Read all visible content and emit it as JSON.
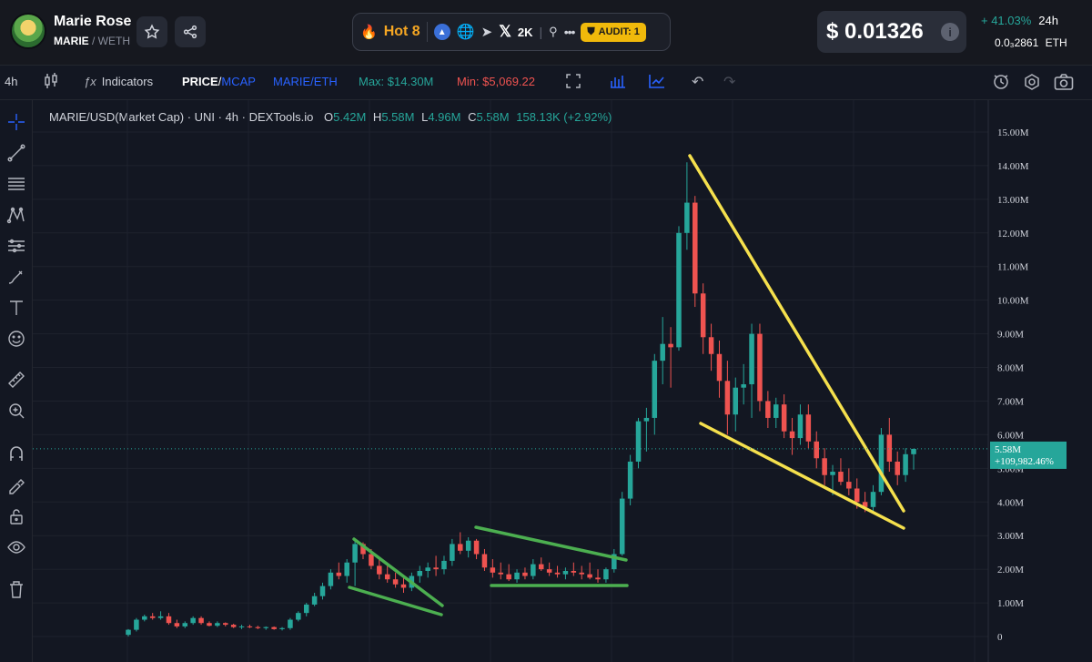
{
  "header": {
    "token_name": "Marie Rose",
    "token_symbol": "MARIE",
    "quote_symbol": "/ WETH",
    "hot_label": "Hot 8",
    "followers": "2K",
    "audit_label": "AUDIT: 1",
    "price": "$ 0.01326",
    "change": "+ 41.03%",
    "change_period": "24h",
    "eth_price": "0.0₃2861",
    "eth_unit": "ETH"
  },
  "toolbar": {
    "interval": "4h",
    "indicators_label": "Indicators",
    "price_label": "PRICE",
    "mcap_label": "MCAP",
    "pair_label": "MARIE/ETH",
    "max_label": "Max: $14.30M",
    "min_label": "Min: $5,069.22"
  },
  "legend": {
    "title": "MARIE/USD(Market Cap) · UNI · 4h · DEXTools.io",
    "o_key": "O",
    "o": "5.42M",
    "h_key": "H",
    "h": "5.58M",
    "l_key": "L",
    "l": "4.96M",
    "c_key": "C",
    "c": "5.58M",
    "change": "158.13K (+2.92%)"
  },
  "colors": {
    "up": "#26a69a",
    "down": "#ef5350",
    "trend_green": "#4caf50",
    "trend_yellow": "#f5e04d",
    "background": "#131722"
  },
  "chart_data": {
    "type": "candlestick",
    "title": "MARIE/USD(Market Cap) · UNI · 4h · DEXTools.io",
    "ylim": [
      0,
      15.5
    ],
    "y_unit": "M",
    "y_ticks": [
      "0",
      "1.00M",
      "2.00M",
      "3.00M",
      "4.00M",
      "5.00M",
      "6.00M",
      "7.00M",
      "8.00M",
      "9.00M",
      "10.00M",
      "11.00M",
      "12.00M",
      "13.00M",
      "14.00M",
      "15.00M"
    ],
    "last_price_label": "5.58M",
    "last_change_label": "+109,982.46%",
    "last_value": 5.58,
    "grid": true,
    "candles": [
      [
        0.05,
        0.22,
        0.0,
        0.2
      ],
      [
        0.2,
        0.55,
        0.15,
        0.5
      ],
      [
        0.5,
        0.65,
        0.45,
        0.6
      ],
      [
        0.6,
        0.7,
        0.5,
        0.55
      ],
      [
        0.55,
        0.75,
        0.5,
        0.6
      ],
      [
        0.6,
        0.7,
        0.35,
        0.4
      ],
      [
        0.4,
        0.5,
        0.25,
        0.3
      ],
      [
        0.3,
        0.45,
        0.25,
        0.4
      ],
      [
        0.4,
        0.6,
        0.35,
        0.55
      ],
      [
        0.55,
        0.6,
        0.35,
        0.4
      ],
      [
        0.4,
        0.45,
        0.3,
        0.32
      ],
      [
        0.32,
        0.45,
        0.28,
        0.4
      ],
      [
        0.4,
        0.42,
        0.3,
        0.35
      ],
      [
        0.35,
        0.38,
        0.25,
        0.28
      ],
      [
        0.28,
        0.35,
        0.22,
        0.3
      ],
      [
        0.3,
        0.35,
        0.25,
        0.28
      ],
      [
        0.28,
        0.32,
        0.22,
        0.25
      ],
      [
        0.25,
        0.3,
        0.2,
        0.28
      ],
      [
        0.28,
        0.3,
        0.2,
        0.22
      ],
      [
        0.22,
        0.28,
        0.18,
        0.25
      ],
      [
        0.25,
        0.55,
        0.2,
        0.5
      ],
      [
        0.5,
        0.75,
        0.45,
        0.7
      ],
      [
        0.7,
        1.0,
        0.6,
        0.95
      ],
      [
        0.95,
        1.3,
        0.9,
        1.2
      ],
      [
        1.2,
        1.6,
        1.1,
        1.5
      ],
      [
        1.5,
        2.0,
        1.4,
        1.9
      ],
      [
        1.9,
        2.2,
        1.7,
        1.8
      ],
      [
        1.8,
        2.3,
        1.6,
        2.2
      ],
      [
        2.2,
        2.9,
        1.5,
        2.75
      ],
      [
        2.75,
        2.8,
        2.3,
        2.45
      ],
      [
        2.45,
        2.6,
        2.0,
        2.1
      ],
      [
        2.1,
        2.3,
        1.7,
        1.85
      ],
      [
        1.85,
        2.1,
        1.6,
        1.7
      ],
      [
        1.7,
        1.9,
        1.45,
        1.55
      ],
      [
        1.55,
        1.8,
        1.3,
        1.45
      ],
      [
        1.45,
        1.9,
        1.35,
        1.8
      ],
      [
        1.8,
        2.1,
        1.6,
        1.95
      ],
      [
        1.95,
        2.2,
        1.75,
        2.05
      ],
      [
        2.05,
        2.4,
        1.8,
        2.0
      ],
      [
        2.0,
        2.4,
        1.85,
        2.25
      ],
      [
        2.25,
        2.9,
        2.1,
        2.75
      ],
      [
        2.75,
        3.1,
        2.45,
        2.55
      ],
      [
        2.55,
        2.95,
        2.35,
        2.85
      ],
      [
        2.85,
        2.9,
        2.3,
        2.45
      ],
      [
        2.45,
        2.6,
        1.95,
        2.05
      ],
      [
        2.05,
        2.3,
        1.75,
        1.9
      ],
      [
        1.9,
        2.2,
        1.7,
        1.85
      ],
      [
        1.85,
        2.15,
        1.65,
        1.7
      ],
      [
        1.7,
        2.0,
        1.6,
        1.9
      ],
      [
        1.9,
        2.05,
        1.7,
        1.8
      ],
      [
        1.8,
        2.3,
        1.7,
        2.15
      ],
      [
        2.15,
        2.35,
        1.95,
        2.0
      ],
      [
        2.0,
        2.2,
        1.8,
        1.9
      ],
      [
        1.9,
        2.1,
        1.75,
        1.85
      ],
      [
        1.85,
        2.05,
        1.7,
        1.95
      ],
      [
        1.95,
        2.2,
        1.8,
        1.9
      ],
      [
        1.9,
        2.1,
        1.7,
        1.85
      ],
      [
        1.85,
        2.2,
        1.7,
        1.75
      ],
      [
        1.75,
        2.0,
        1.6,
        1.7
      ],
      [
        1.7,
        2.05,
        1.6,
        2.0
      ],
      [
        2.0,
        2.6,
        1.9,
        2.45
      ],
      [
        2.45,
        4.3,
        2.4,
        4.1
      ],
      [
        4.1,
        5.4,
        3.9,
        5.2
      ],
      [
        5.2,
        6.5,
        5.0,
        6.4
      ],
      [
        6.4,
        6.8,
        5.5,
        6.5
      ],
      [
        6.5,
        8.4,
        6.0,
        8.2
      ],
      [
        8.2,
        9.5,
        7.5,
        8.7
      ],
      [
        8.7,
        9.2,
        7.4,
        8.6
      ],
      [
        8.6,
        12.2,
        8.5,
        12.0
      ],
      [
        12.0,
        14.1,
        11.5,
        12.9
      ],
      [
        12.9,
        13.1,
        9.8,
        10.2
      ],
      [
        10.2,
        10.5,
        8.4,
        8.9
      ],
      [
        8.9,
        9.3,
        7.9,
        8.4
      ],
      [
        8.4,
        8.8,
        7.1,
        7.6
      ],
      [
        7.6,
        8.2,
        6.0,
        6.6
      ],
      [
        6.6,
        7.7,
        6.1,
        7.4
      ],
      [
        7.4,
        8.1,
        6.9,
        7.5
      ],
      [
        7.5,
        9.3,
        6.5,
        9.0
      ],
      [
        9.0,
        9.3,
        6.7,
        7.0
      ],
      [
        7.0,
        7.3,
        6.2,
        6.5
      ],
      [
        6.5,
        7.1,
        6.2,
        6.9
      ],
      [
        6.9,
        7.2,
        5.9,
        6.1
      ],
      [
        6.1,
        6.5,
        5.4,
        5.9
      ],
      [
        5.9,
        6.9,
        5.7,
        6.6
      ],
      [
        6.6,
        6.9,
        5.6,
        5.8
      ],
      [
        5.8,
        6.1,
        5.0,
        5.3
      ],
      [
        5.3,
        5.6,
        4.5,
        4.8
      ],
      [
        4.8,
        5.1,
        4.2,
        4.9
      ],
      [
        4.9,
        5.3,
        4.5,
        4.6
      ],
      [
        4.6,
        5.0,
        4.2,
        4.4
      ],
      [
        4.4,
        4.7,
        3.8,
        4.0
      ],
      [
        4.0,
        4.3,
        3.7,
        3.85
      ],
      [
        3.85,
        4.5,
        3.7,
        4.3
      ],
      [
        4.3,
        6.2,
        4.2,
        6.0
      ],
      [
        6.0,
        6.5,
        4.9,
        5.2
      ],
      [
        5.2,
        5.5,
        4.5,
        4.8
      ],
      [
        4.8,
        5.6,
        4.6,
        5.42
      ],
      [
        5.42,
        5.58,
        4.96,
        5.58
      ]
    ],
    "annotations": [
      {
        "color": "green",
        "type": "falling wedge"
      },
      {
        "color": "green",
        "type": "descending triangle"
      },
      {
        "color": "yellow",
        "type": "falling wedge"
      }
    ]
  }
}
